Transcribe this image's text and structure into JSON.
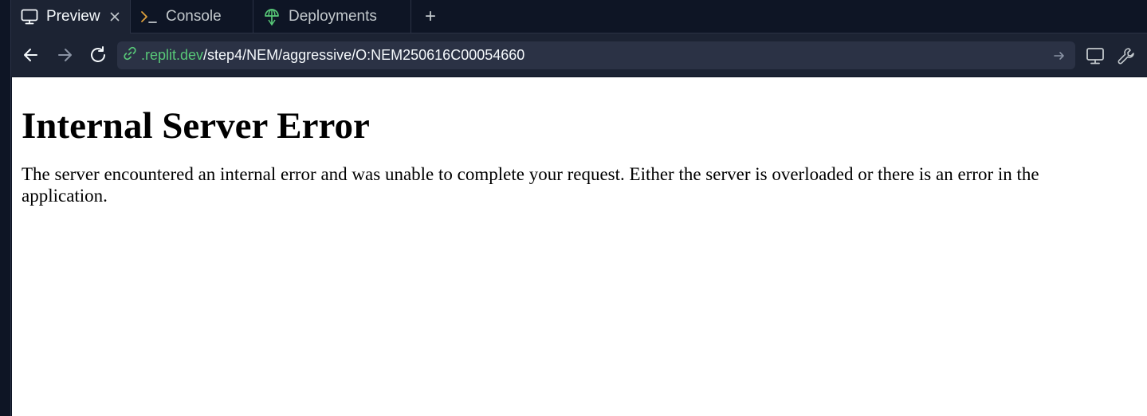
{
  "tabs": [
    {
      "label": "Preview",
      "icon": "monitor-icon",
      "active": true,
      "closable": true
    },
    {
      "label": "Console",
      "icon": "terminal-icon",
      "active": false
    },
    {
      "label": "Deployments",
      "icon": "deploy-icon",
      "active": false
    }
  ],
  "new_tab": "+",
  "address": {
    "domain": ".replit.dev",
    "path": "/step4/NEM/aggressive/O:NEM250616C00054660"
  },
  "page": {
    "heading": "Internal Server Error",
    "message": "The server encountered an internal error and was unable to complete your request. Either the server is overloaded or there is an error in the application."
  },
  "colors": {
    "chrome_bg": "#0e1525",
    "toolbar_bg": "#1c2333",
    "field_bg": "#2b3245",
    "domain_green": "#58c878"
  }
}
